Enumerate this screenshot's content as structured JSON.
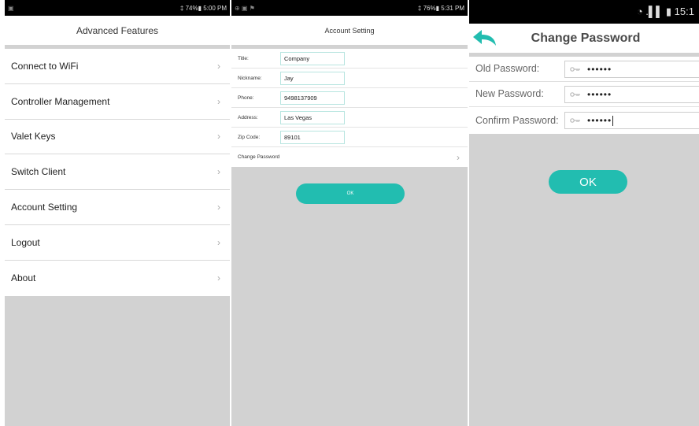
{
  "advanced": {
    "status": {
      "left": "▣",
      "right": "‡ 74%▮ 5:00 PM"
    },
    "title": "Advanced Features",
    "items": [
      {
        "label": "Connect to WiFi"
      },
      {
        "label": "Controller Management"
      },
      {
        "label": "Valet Keys"
      },
      {
        "label": "Switch Client"
      },
      {
        "label": "Account Setting"
      },
      {
        "label": "Logout"
      },
      {
        "label": "About"
      }
    ]
  },
  "account": {
    "status": {
      "left": "⊕ ▣ ⚑",
      "right": "‡ 76%▮ 5:31 PM"
    },
    "title": "Account Setting",
    "fields": [
      {
        "label": "Title:",
        "value": "Company"
      },
      {
        "label": "Nickname:",
        "value": "Jay"
      },
      {
        "label": "Phone:",
        "value": "9498137909"
      },
      {
        "label": "Address:",
        "value": "Las Vegas"
      },
      {
        "label": "Zip Code:",
        "value": "89101"
      }
    ],
    "change_password": "Change Password",
    "ok": "OK"
  },
  "change_password": {
    "status": {
      "right": "◔ .▌▌ ▮ 15:1"
    },
    "title": "Change Password",
    "fields": [
      {
        "label": "Old Password:",
        "value": "••••••"
      },
      {
        "label": "New Password:",
        "value": "••••••"
      },
      {
        "label": "Confirm Password:",
        "value": "••••••"
      }
    ],
    "ok": "OK"
  },
  "colors": {
    "accent": "#22bdb0",
    "background": "#d2d2d2"
  },
  "icons": {
    "chevron": "›",
    "back": "back-arrow-icon",
    "key": "key-icon"
  }
}
